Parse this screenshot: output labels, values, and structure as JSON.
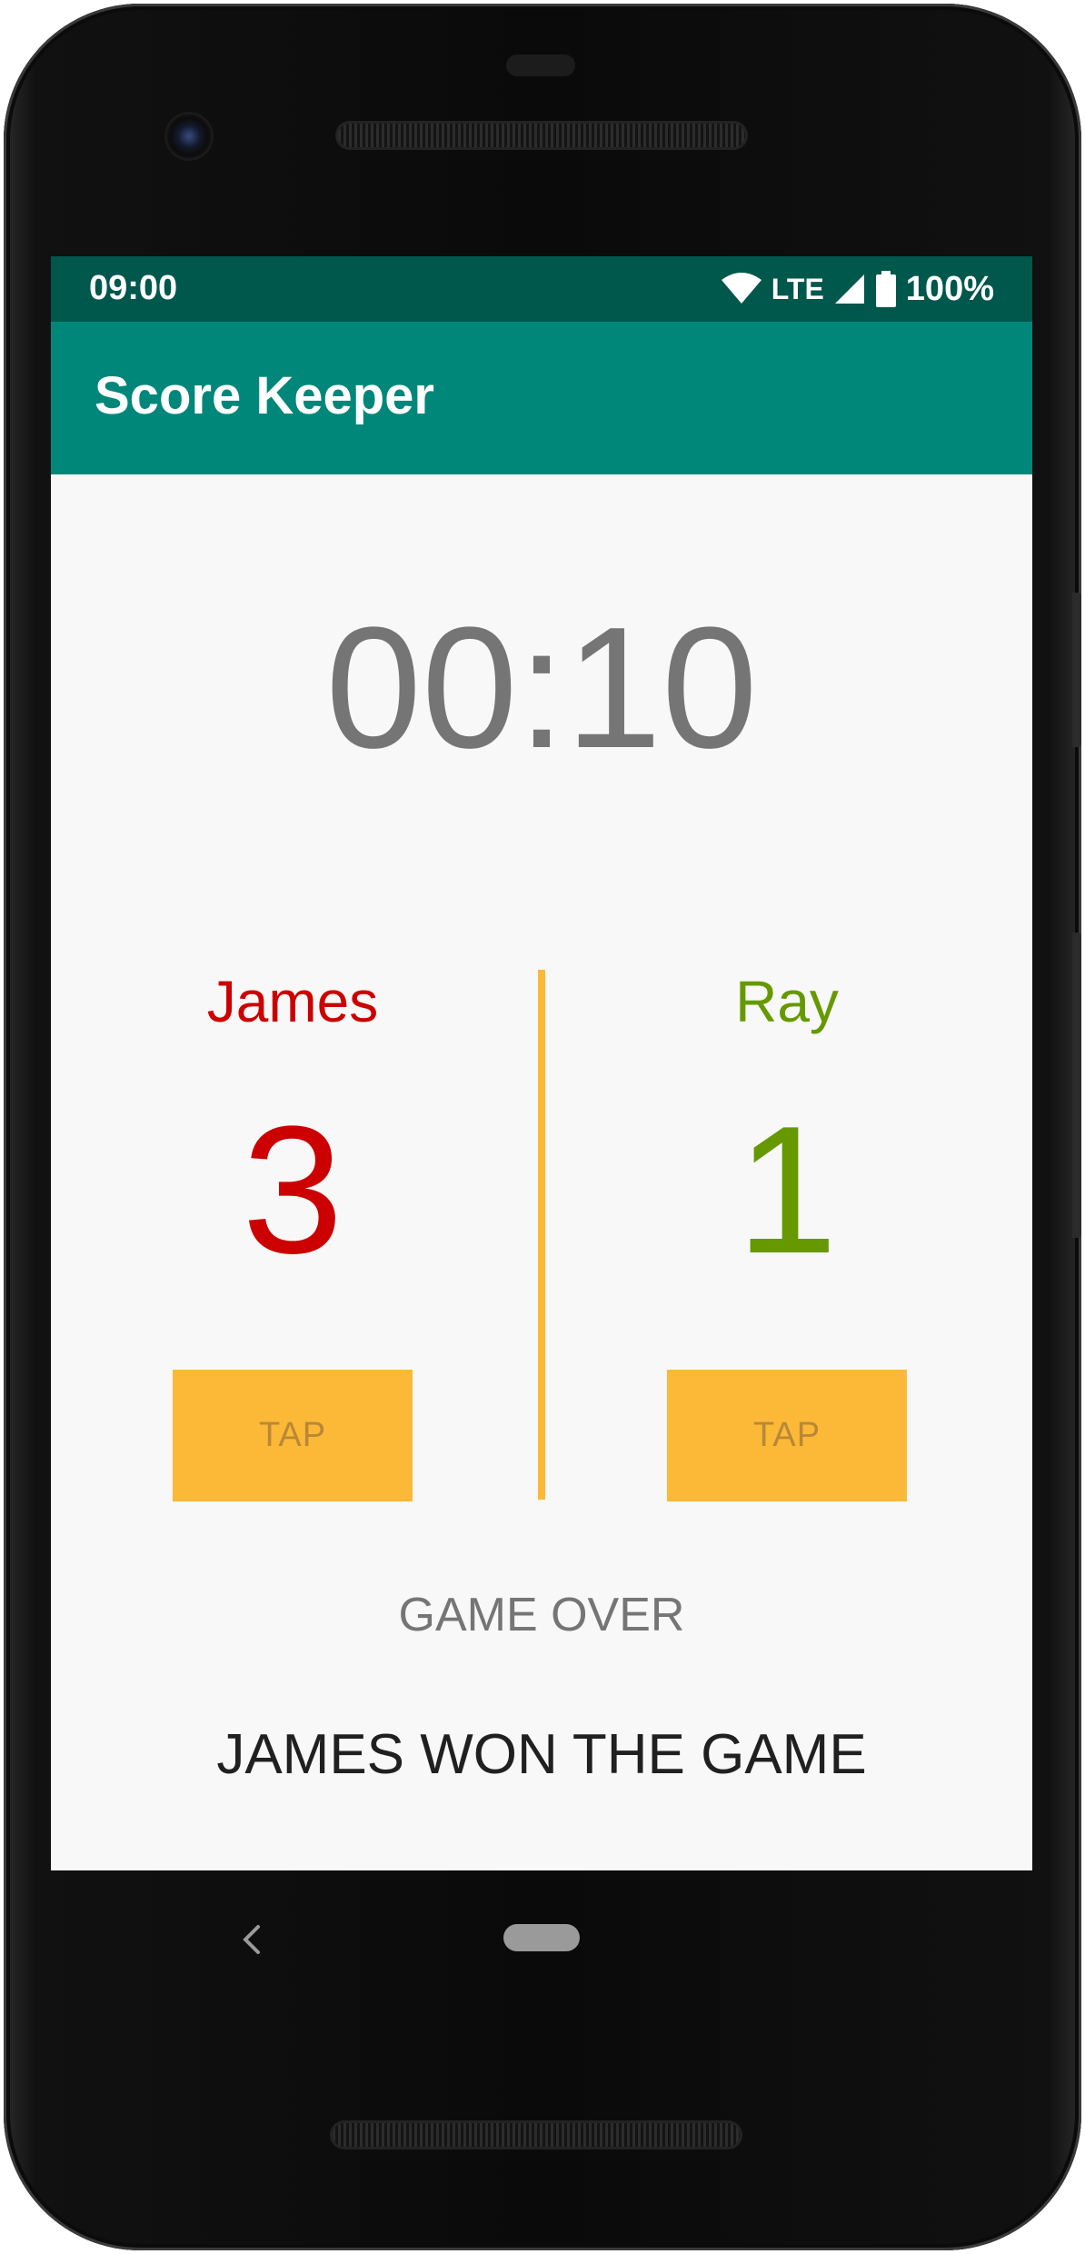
{
  "status_bar": {
    "time": "09:00",
    "network": "LTE",
    "battery": "100%",
    "icons": [
      "wifi-icon",
      "cell-signal-icon",
      "battery-icon"
    ]
  },
  "app_bar": {
    "title": "Score Keeper"
  },
  "timer": "00:10",
  "players": [
    {
      "name": "James",
      "score": "3",
      "button_label": "TAP",
      "color": "#cc0000"
    },
    {
      "name": "Ray",
      "score": "1",
      "button_label": "TAP",
      "color": "#669900"
    }
  ],
  "game_over_label": "GAME OVER",
  "result_text": "JAMES WON THE GAME",
  "colors": {
    "status_bar": "#00574b",
    "app_bar": "#00877a",
    "accent": "#fbb937",
    "background": "#f8f8f8"
  },
  "nav_bar": {
    "icons": [
      "back-icon",
      "home-icon"
    ]
  }
}
